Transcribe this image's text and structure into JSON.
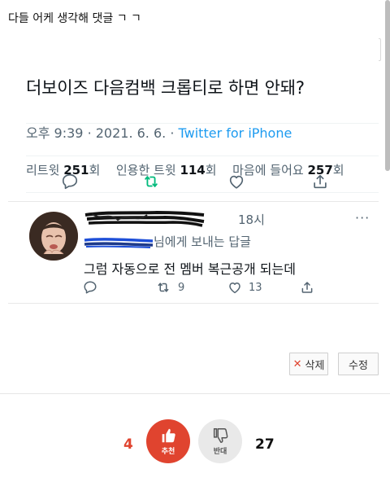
{
  "post": {
    "title": "다들 어케 생각해 댓글 ㄱ ㄱ"
  },
  "tweet": {
    "text": "더보이즈 다음컴백 크롭티로 하면 안돼?",
    "time": "오후 9:39",
    "date": "2021. 6. 6.",
    "source": "Twitter for iPhone",
    "stats": {
      "retweets_label": "리트윗",
      "retweets": "251",
      "quotes_label": "인용한 트윗",
      "quotes": "114",
      "likes_label": "마음에 들어요",
      "likes": "257",
      "unit": "회"
    }
  },
  "reply": {
    "time": "18시",
    "reply_to_suffix": "님에게 보내는 답글",
    "text": "그럼 자동으로 전 멤버 복근공개 되는데",
    "retweets": "9",
    "likes": "13"
  },
  "buttons": {
    "delete_label": "삭제",
    "edit_label": "수정"
  },
  "votes": {
    "up_count": "4",
    "up_label": "추천",
    "down_count": "27",
    "down_label": "반대"
  },
  "colors": {
    "twitter_blue": "#1d9bf0",
    "retweet_green": "#00ba7c",
    "vote_red": "#e0442f",
    "text_gray": "#536471"
  }
}
